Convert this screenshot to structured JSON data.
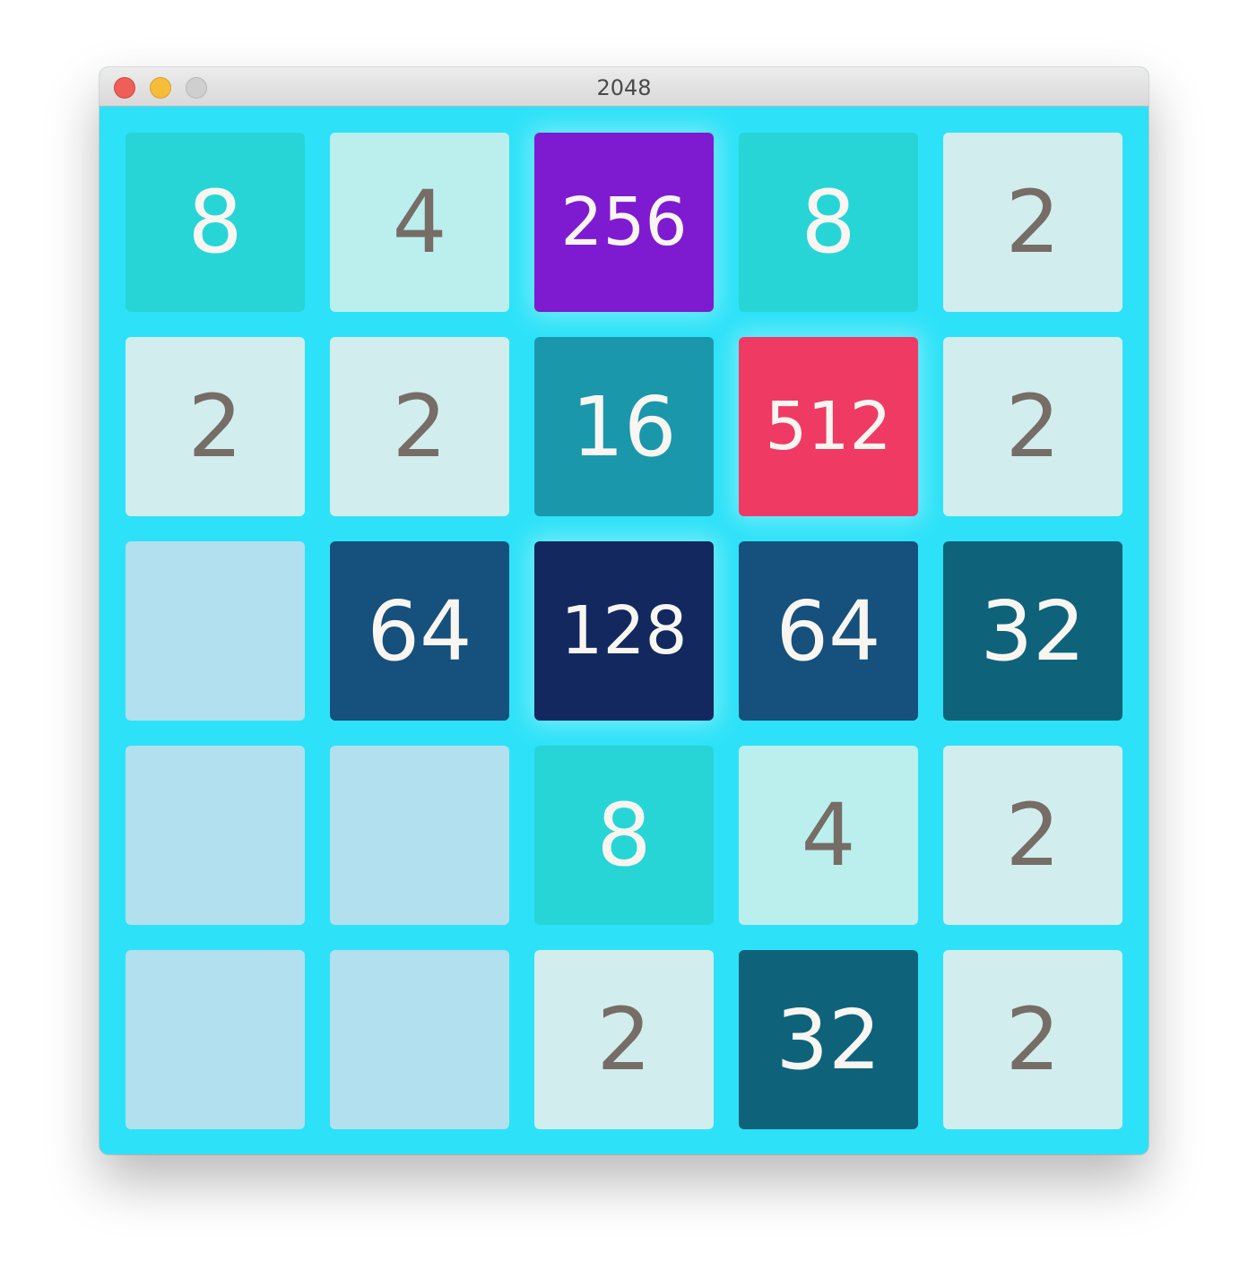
{
  "window": {
    "title": "2048"
  },
  "colors": {
    "board": "#2de2f8",
    "empty": "#b3e0ee",
    "tile_2": "#d2eded",
    "tile_4": "#bbefee",
    "tile_8": "#27d5d7",
    "tile_16": "#1a97ab",
    "tile_32": "#0e637a",
    "tile_64": "#16507c",
    "tile_128": "#12285f",
    "tile_256": "#7e1bd1",
    "tile_512": "#ef3a63",
    "dark_text": "#766d66",
    "light_text": "#f9f6f2"
  },
  "board": {
    "rows": [
      [
        "8",
        "4",
        "256",
        "8",
        "2"
      ],
      [
        "2",
        "2",
        "16",
        "512",
        "2"
      ],
      [
        "",
        "64",
        "128",
        "64",
        "32"
      ],
      [
        "",
        "",
        "8",
        "4",
        "2"
      ],
      [
        "",
        "",
        "2",
        "32",
        "2"
      ]
    ]
  }
}
